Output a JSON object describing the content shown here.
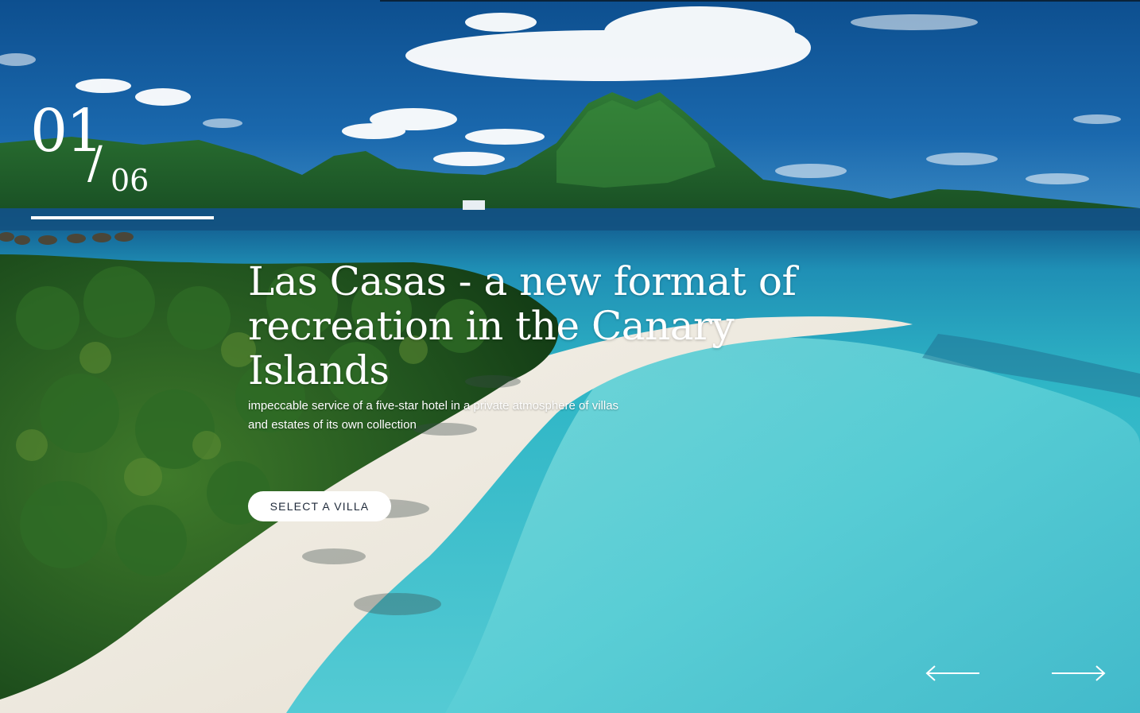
{
  "slider": {
    "current": "01",
    "separator": "/",
    "total": "06"
  },
  "hero": {
    "headline": "Las Casas - a new format of recreation in the Canary Islands",
    "subtitle": "impeccable service of a five-star hotel in a private atmosphere of villas and estates of its own collection",
    "cta_label": "SELECT A VILLA"
  },
  "navigation": {
    "prev_icon": "arrow-left-icon",
    "next_icon": "arrow-right-icon"
  },
  "colors": {
    "sky": "#1a5f9e",
    "lagoon": "#3fc3cf",
    "sand": "#f1ede4",
    "foliage": "#1f5a26",
    "text": "#ffffff",
    "button_text": "#1f2a3a"
  }
}
